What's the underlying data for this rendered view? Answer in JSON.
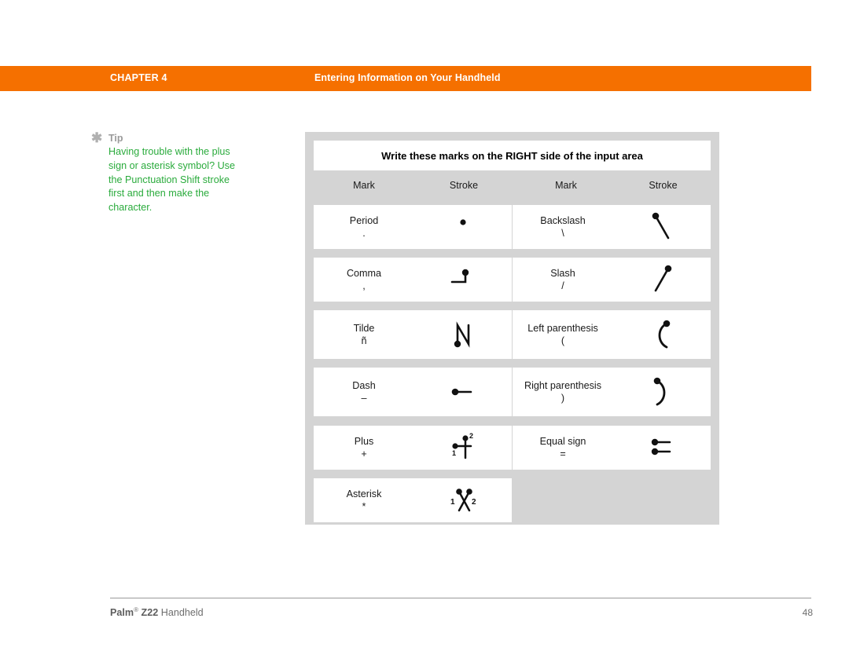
{
  "header": {
    "chapter_label": "CHAPTER 4",
    "chapter_title": "Entering Information on Your Handheld",
    "bar_color": "#f57000",
    "text_color": "#ffffff"
  },
  "tip": {
    "icon": "asterisk-icon",
    "label": "Tip",
    "body": "Having trouble with the plus sign or asterisk symbol? Use the Punctuation Shift stroke first and then make the character.",
    "label_color": "#9a9a9a",
    "body_color": "#2aab3c"
  },
  "table": {
    "title": "Write these marks on the RIGHT side of the input area",
    "panel_color": "#d4d4d4",
    "cell_color": "#ffffff",
    "columns": [
      "Mark",
      "Stroke",
      "Mark",
      "Stroke"
    ],
    "rows": [
      {
        "left": {
          "name": "Period",
          "glyph": ".",
          "stroke": "dot"
        },
        "right": {
          "name": "Backslash",
          "glyph": "\\",
          "stroke": "backslash"
        }
      },
      {
        "left": {
          "name": "Comma",
          "glyph": ",",
          "stroke": "comma-hook"
        },
        "right": {
          "name": "Slash",
          "glyph": "/",
          "stroke": "slash"
        }
      },
      {
        "left": {
          "name": "Tilde",
          "glyph": "ñ",
          "stroke": "n-shape"
        },
        "right": {
          "name": "Left parenthesis",
          "glyph": "(",
          "stroke": "left-paren-curve"
        }
      },
      {
        "left": {
          "name": "Dash",
          "glyph": "–",
          "stroke": "horizontal-line"
        },
        "right": {
          "name": "Right parenthesis",
          "glyph": ")",
          "stroke": "right-paren-curve"
        }
      },
      {
        "left": {
          "name": "Plus",
          "glyph": "+",
          "stroke": "cross-two-stroke"
        },
        "right": {
          "name": "Equal sign",
          "glyph": "=",
          "stroke": "double-line"
        }
      },
      {
        "left": {
          "name": "Asterisk",
          "glyph": "*",
          "stroke": "x-two-stroke"
        },
        "right": null
      }
    ],
    "stroke_order_labels": {
      "first": "1",
      "second": "2"
    }
  },
  "footer": {
    "brand": "Palm",
    "registered": "®",
    "model": "Z22",
    "product": "Handheld",
    "page_number": "48"
  }
}
